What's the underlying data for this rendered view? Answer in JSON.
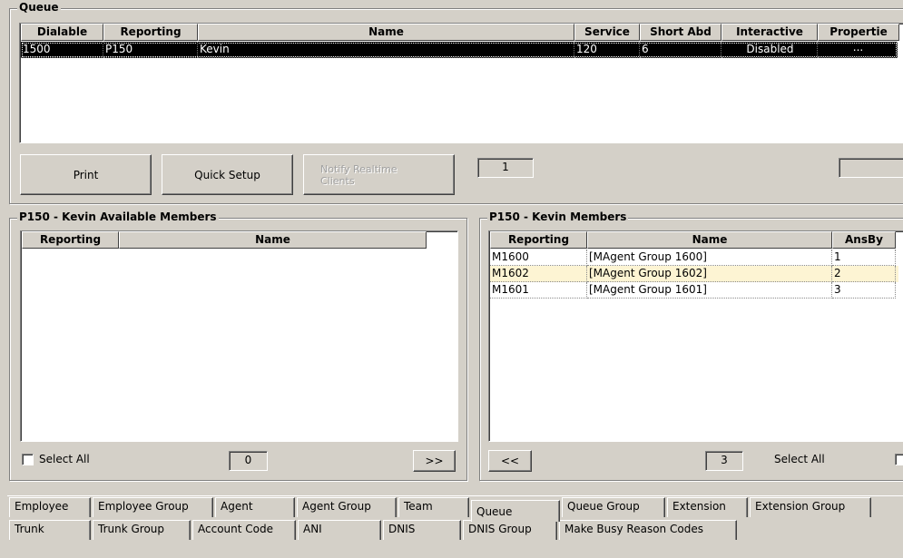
{
  "queue": {
    "title": "Queue",
    "columns": [
      "Dialable",
      "Reporting",
      "Name",
      "Service",
      "Short Abd",
      "Interactive",
      "Propertie"
    ],
    "rows": [
      {
        "dialable": "1500",
        "reporting": "P150",
        "name": "Kevin",
        "service": "120",
        "short_abd": "6",
        "interactive": "Disabled",
        "properties": "..."
      }
    ],
    "buttons": {
      "print": "Print",
      "quick_setup": "Quick Setup",
      "notify_realtime": "Notify Realtime Clients"
    },
    "count": "1",
    "right_field": ""
  },
  "available": {
    "title": "P150 - Kevin Available Members",
    "columns": [
      "Reporting",
      "Name"
    ],
    "select_all": "Select All",
    "count": "0",
    "add_button": ">>"
  },
  "members": {
    "title": "P150 - Kevin Members",
    "columns": [
      "Reporting",
      "Name",
      "AnsBy"
    ],
    "rows": [
      {
        "reporting": "M1600",
        "name": "[MAgent Group 1600]",
        "ansby": "1"
      },
      {
        "reporting": "M1602",
        "name": "[MAgent Group 1602]",
        "ansby": "2"
      },
      {
        "reporting": "M1601",
        "name": "[MAgent Group 1601]",
        "ansby": "3"
      }
    ],
    "remove_button": "<<",
    "count": "3",
    "select_all": "Select All"
  },
  "tabs": {
    "row1": [
      "Employee",
      "Employee Group",
      "Agent",
      "Agent Group",
      "Team",
      "Queue",
      "Queue Group",
      "Extension",
      "Extension Group"
    ],
    "row2": [
      "Trunk",
      "Trunk Group",
      "Account Code",
      "ANI",
      "DNIS",
      "DNIS Group",
      "Make Busy Reason Codes"
    ],
    "active": "Queue"
  },
  "colors": {
    "face": "#d4d0c8",
    "selected_row": "#000000",
    "highlight_row": "#fdf4d3"
  }
}
